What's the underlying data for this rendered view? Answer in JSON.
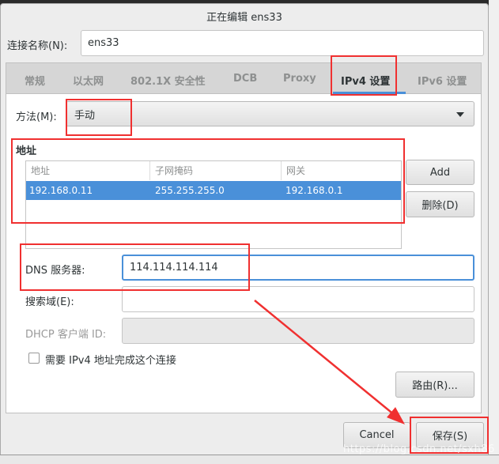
{
  "dialog": {
    "title": "正在编辑 ens33"
  },
  "connection_name": {
    "label": "连接名称(N):",
    "value": "ens33"
  },
  "tabs": [
    {
      "label": "常规"
    },
    {
      "label": "以太网"
    },
    {
      "label": "802.1X 安全性"
    },
    {
      "label": "DCB"
    },
    {
      "label": "Proxy"
    },
    {
      "label": "IPv4 设置",
      "active": true
    },
    {
      "label": "IPv6 设置"
    }
  ],
  "method": {
    "label": "方法(M):",
    "value": "手动"
  },
  "addresses": {
    "heading": "地址",
    "columns": [
      "地址",
      "子网掩码",
      "网关"
    ],
    "rows": [
      [
        "192.168.0.11",
        "255.255.255.0",
        "192.168.0.1"
      ]
    ],
    "add_label": "Add",
    "delete_label": "删除(D)"
  },
  "dns": {
    "label": "DNS 服务器:",
    "value": "114.114.114.114"
  },
  "search_domain": {
    "label": "搜索域(E):",
    "value": ""
  },
  "dhcp_client_id": {
    "label": "DHCP 客户端 ID:",
    "value": ""
  },
  "require_ipv4": {
    "label": "需要 IPv4 地址完成这个连接",
    "checked": false
  },
  "routes_label": "路由(R)...",
  "cancel_label": "Cancel",
  "save_label": "保存(S)",
  "watermark": "https://blog.csdn.net/sxh86",
  "colors": {
    "accent": "#4a90d9",
    "highlight": "#f03030"
  }
}
